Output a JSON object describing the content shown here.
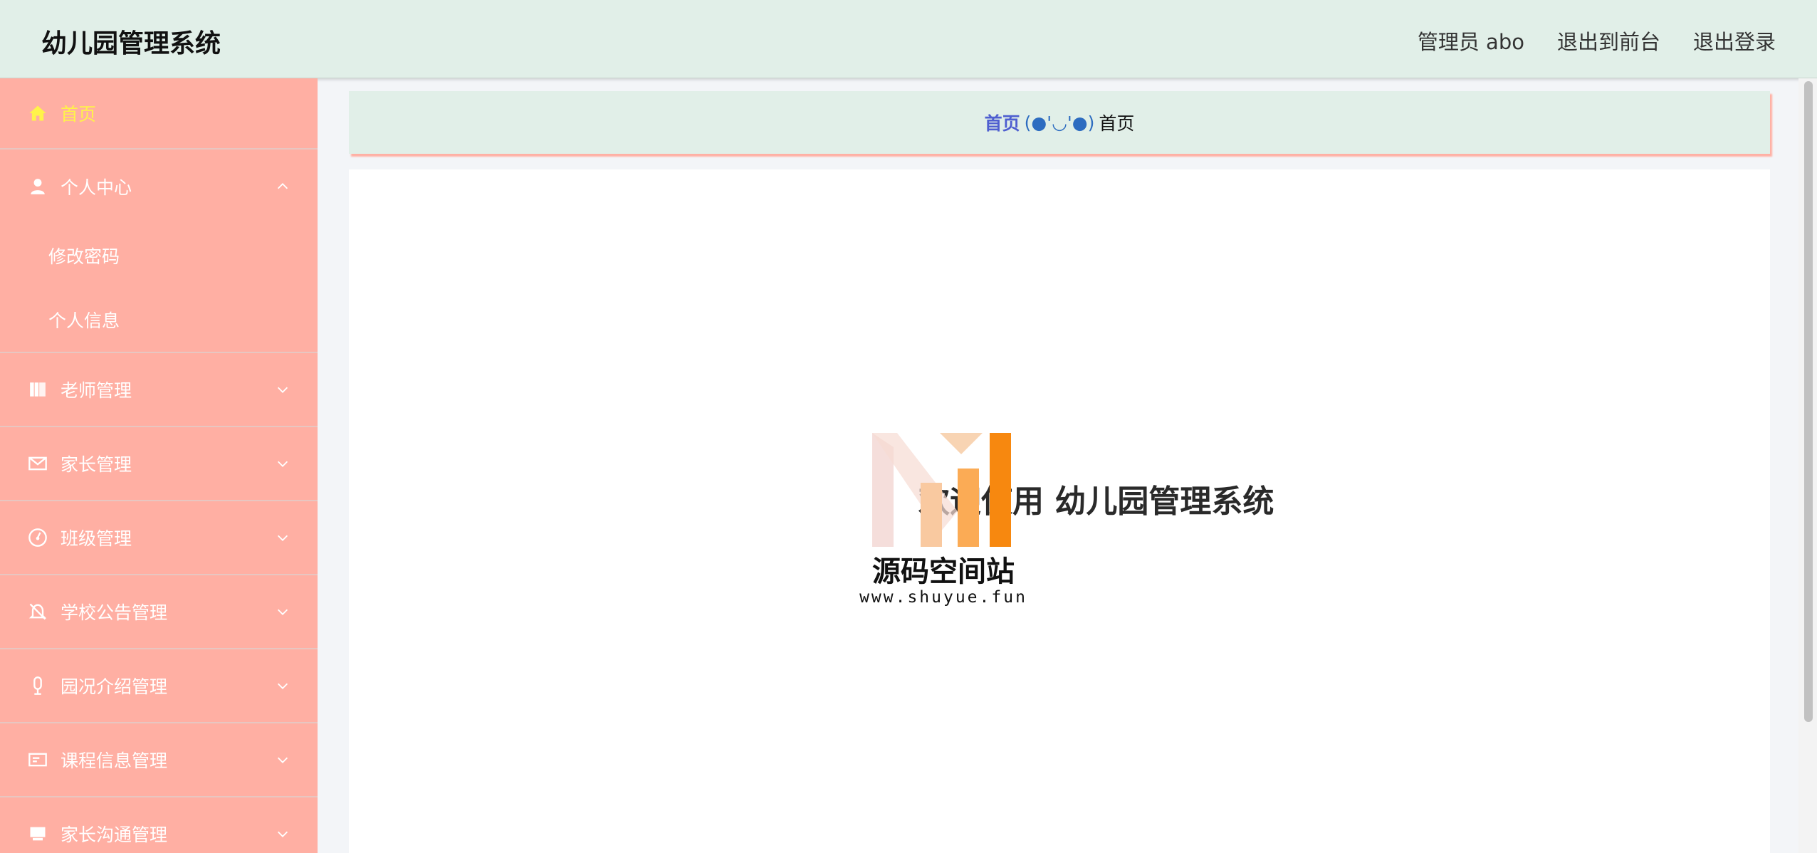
{
  "header": {
    "title": "幼儿园管理系统",
    "user_label": "管理员 abo",
    "front_label": "退出到前台",
    "logout_label": "退出登录"
  },
  "sidebar": {
    "items": [
      {
        "label": "首页",
        "icon": "home-icon"
      },
      {
        "label": "个人中心",
        "icon": "user-icon",
        "children": [
          "修改密码",
          "个人信息"
        ]
      },
      {
        "label": "老师管理",
        "icon": "book-icon"
      },
      {
        "label": "家长管理",
        "icon": "mail-icon"
      },
      {
        "label": "班级管理",
        "icon": "gauge-icon"
      },
      {
        "label": "学校公告管理",
        "icon": "bell-off-icon"
      },
      {
        "label": "园况介绍管理",
        "icon": "microphone-icon"
      },
      {
        "label": "课程信息管理",
        "icon": "id-card-icon"
      },
      {
        "label": "家长沟通管理",
        "icon": "monitor-icon"
      }
    ]
  },
  "breadcrumb": {
    "home": "首页",
    "separator": "(●'◡'●)",
    "current": "首页"
  },
  "main": {
    "welcome": "欢迎使用 幼儿园管理系统"
  },
  "watermark": {
    "text": "源码空间站",
    "url": "www.shuyue.fun"
  },
  "colors": {
    "header_bg": "#e1efe8",
    "sidebar_bg": "#ffafa3",
    "active_text": "#fff34a",
    "breadcrumb_link": "#4f5fd0"
  }
}
